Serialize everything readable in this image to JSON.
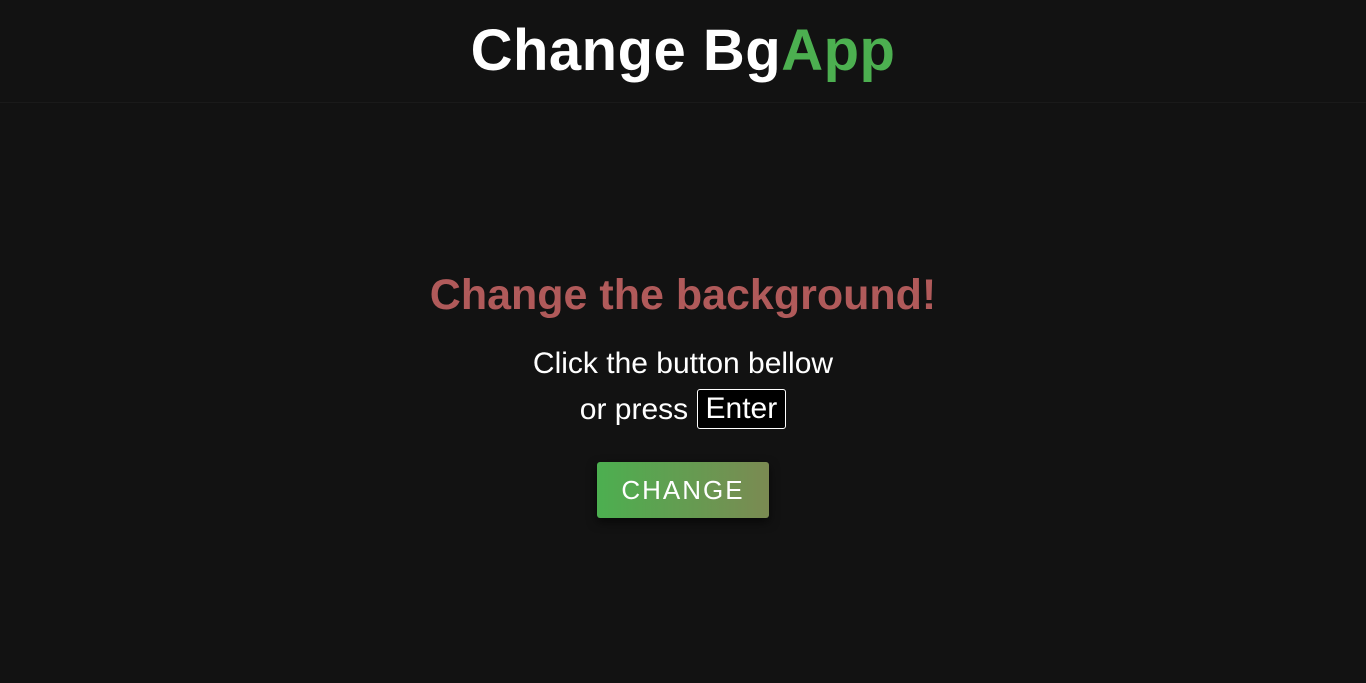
{
  "header": {
    "title_main": "Change Bg",
    "title_accent": "App"
  },
  "main": {
    "headline": "Change the background!",
    "instruction_line1": "Click the button bellow",
    "instruction_line2_prefix": "or press",
    "key_label": "Enter",
    "button_label": "CHANGE"
  },
  "colors": {
    "background": "#121212",
    "accent_green": "#4caf50",
    "headline_red": "#b05a5a",
    "text": "#ffffff"
  }
}
